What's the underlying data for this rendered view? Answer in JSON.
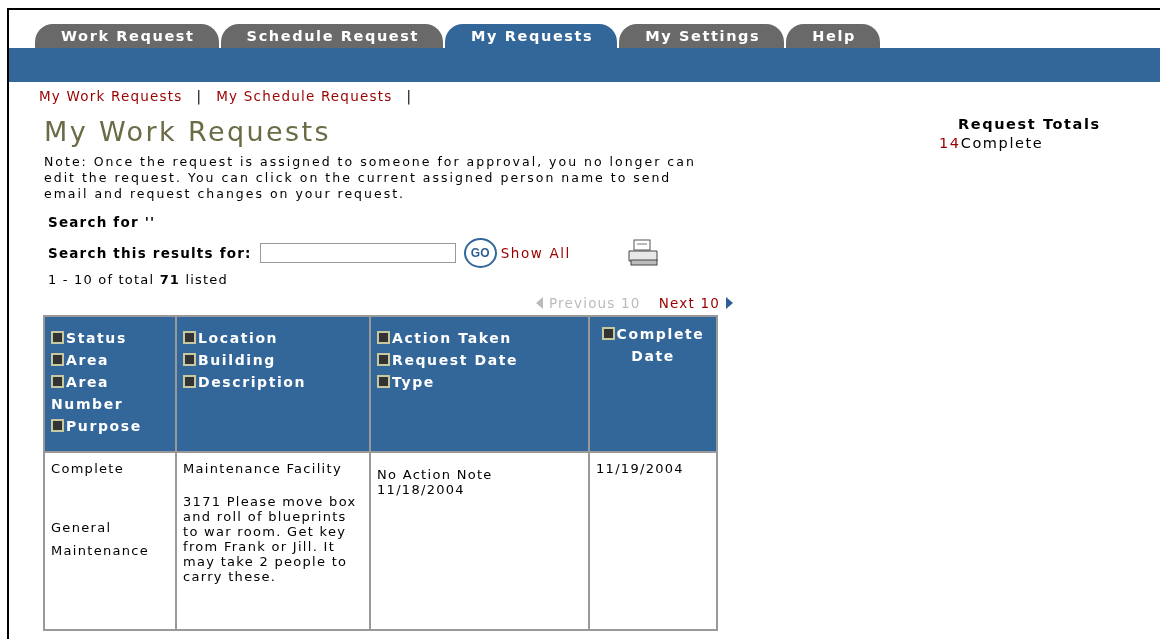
{
  "tabs": [
    {
      "label": "Work Request",
      "selected": false
    },
    {
      "label": "Schedule Request",
      "selected": false
    },
    {
      "label": "My Requests",
      "selected": true
    },
    {
      "label": "My Settings",
      "selected": false
    },
    {
      "label": "Help",
      "selected": false
    }
  ],
  "sub_links": [
    {
      "label": "My Work Requests",
      "separator": "|"
    },
    {
      "label": "My Schedule Requests",
      "separator": "|"
    }
  ],
  "title": "My Work Requests",
  "note": "Note: Once the request is assigned to someone for approval, you no longer can edit the request. You can click on the current assigned person name to send email and request changes on your request.",
  "search_for": "Search for ''",
  "search": {
    "label": "Search this results for:",
    "go": "GO",
    "show_all": "Show All"
  },
  "listed": "1 - 10 of total **71** listed",
  "pager": [
    {
      "label": "Previous 10",
      "disabled": true
    },
    {
      "label": "Next 10",
      "disabled": false
    }
  ],
  "table": {
    "columns": [
      {
        "fields": [
          "Status",
          "Area",
          "Area Number",
          "Purpose"
        ]
      },
      {
        "fields": [
          "Location",
          "Building",
          "Description"
        ]
      },
      {
        "fields": [
          "Action Taken",
          "Request Date",
          "Type"
        ]
      },
      {
        "fields": [
          "Complete Date"
        ]
      }
    ],
    "rows": [
      [
        [
          "Complete",
          "General Maintenance"
        ],
        [
          "Maintenance Facility",
          "3171 Please move box and roll of blueprints to war room. Get key from Frank or Jill. It may take 2 people to carry these."
        ],
        [
          "No Action Note 11/18/2004"
        ],
        [
          "11/19/2004"
        ]
      ]
    ]
  },
  "totals": {
    "title": "Request Totals",
    "items": [
      {
        "count": "14",
        "label": "Complete"
      }
    ]
  }
}
